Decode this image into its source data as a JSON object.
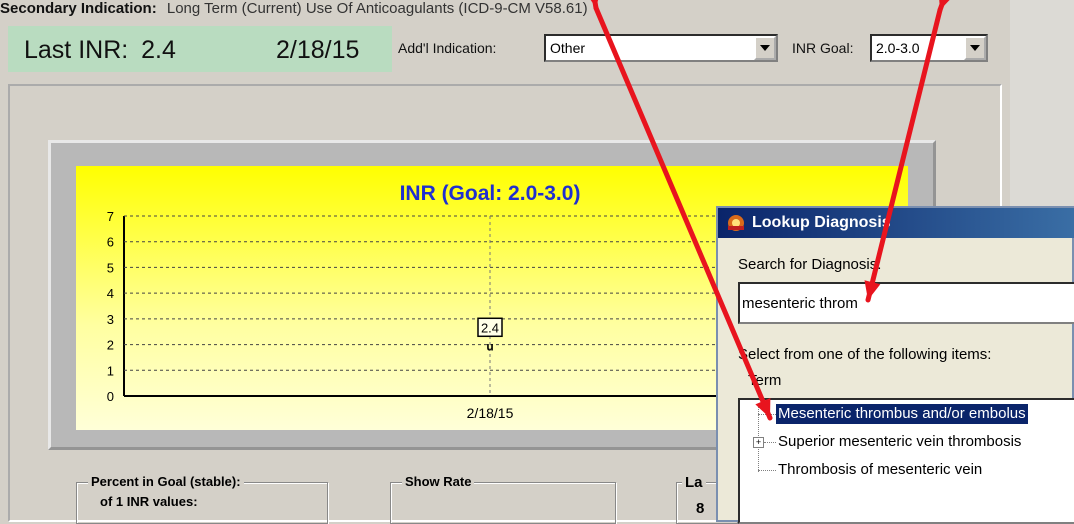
{
  "header": {
    "secondary_label": "Secondary Indication:",
    "secondary_value": "Long Term (Current) Use Of Anticoagulants (ICD-9-CM V58.61)"
  },
  "inr_summary": {
    "last_inr_label": "Last INR:",
    "last_inr_value": "2.4",
    "last_date": "2/18/15"
  },
  "addl_indication": {
    "label": "Add'l Indication:",
    "value": "Other"
  },
  "inr_goal": {
    "label": "INR Goal:",
    "value": "2.0-3.0"
  },
  "chart_data": {
    "type": "scatter",
    "title": "INR  (Goal: 2.0-3.0)",
    "x": [
      "2/18/15"
    ],
    "y": [
      2.4
    ],
    "point_labels": [
      "2.4"
    ],
    "ylim": [
      0,
      7
    ],
    "yticks": [
      0,
      1,
      2,
      3,
      4,
      5,
      6,
      7
    ],
    "grid": true,
    "marker_glyph": "u",
    "colors": {
      "title": "#1f2fd0",
      "background_top": "#ffff00",
      "frame": "#b8b8b8"
    }
  },
  "stats": {
    "percent_in_goal_title": "Percent in Goal (stable):",
    "percent_in_goal_sub": "of 1 INR values:",
    "show_rate_title": "Show Rate",
    "third_title_partial": "La",
    "third_value_partial": "8"
  },
  "dialog": {
    "title": "Lookup Diagnosis",
    "search_label": "Search for Diagnosis:",
    "search_value": "mesenteric throm",
    "select_label": "Select from one of the following items:",
    "column_header": "Term",
    "items": [
      {
        "label": "Mesenteric thrombus and/or embolus",
        "selected": true,
        "expandable": false
      },
      {
        "label": "Superior mesenteric vein thrombosis",
        "selected": false,
        "expandable": true
      },
      {
        "label": "Thrombosis of mesenteric vein",
        "selected": false,
        "expandable": false
      }
    ]
  },
  "annotation": {
    "arrow_color": "#e8141e"
  }
}
